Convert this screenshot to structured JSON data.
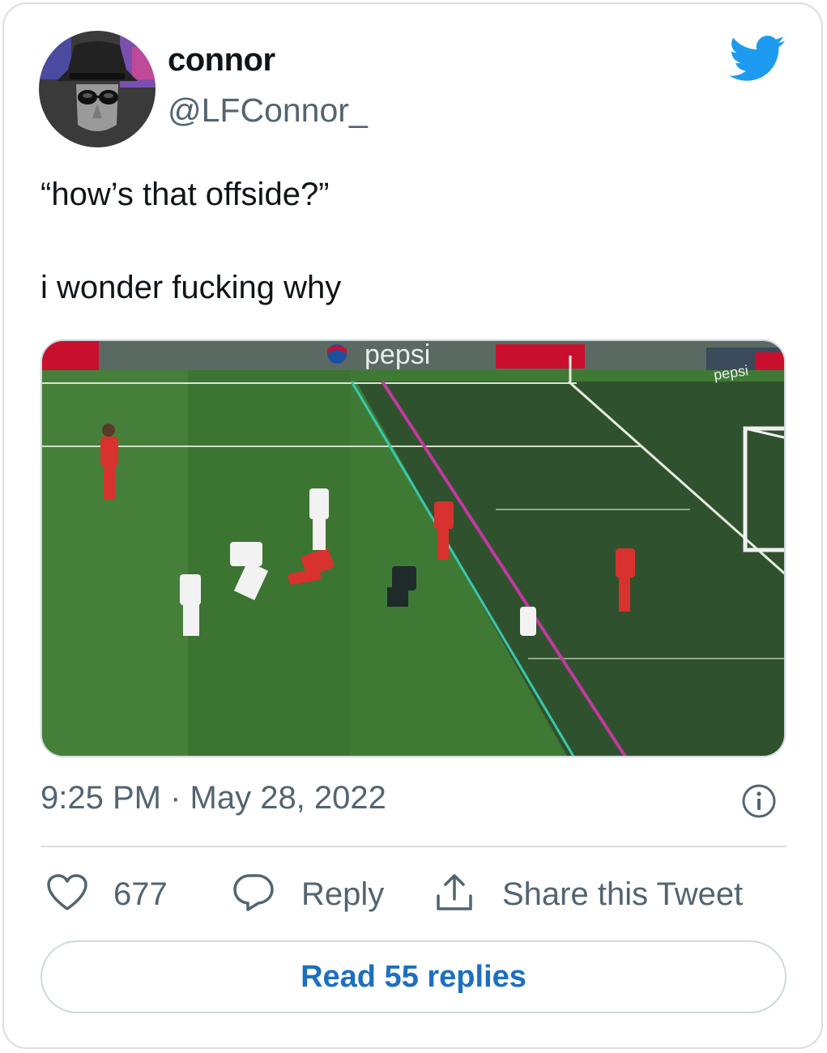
{
  "author": {
    "name": "connor",
    "handle": "@LFConnor_"
  },
  "tweet": {
    "line1": "“how’s that offside?”",
    "line2": "i wonder fucking why"
  },
  "media": {
    "sponsor_text": "pepsi",
    "sponsor_text_small": "pepsi"
  },
  "meta": {
    "timestamp": "9:25 PM · May 28, 2022"
  },
  "actions": {
    "likes": "677",
    "reply_label": "Reply",
    "share_label": "Share this Tweet"
  },
  "footer": {
    "read_replies": "Read 55 replies"
  },
  "colors": {
    "twitter_blue": "#1d9bf0",
    "link_blue": "#1d6fbf",
    "text_primary": "#0f1419",
    "text_secondary": "#536471"
  },
  "icons": [
    "twitter-bird-icon",
    "info-icon",
    "heart-icon",
    "reply-bubble-icon",
    "share-upload-icon"
  ]
}
